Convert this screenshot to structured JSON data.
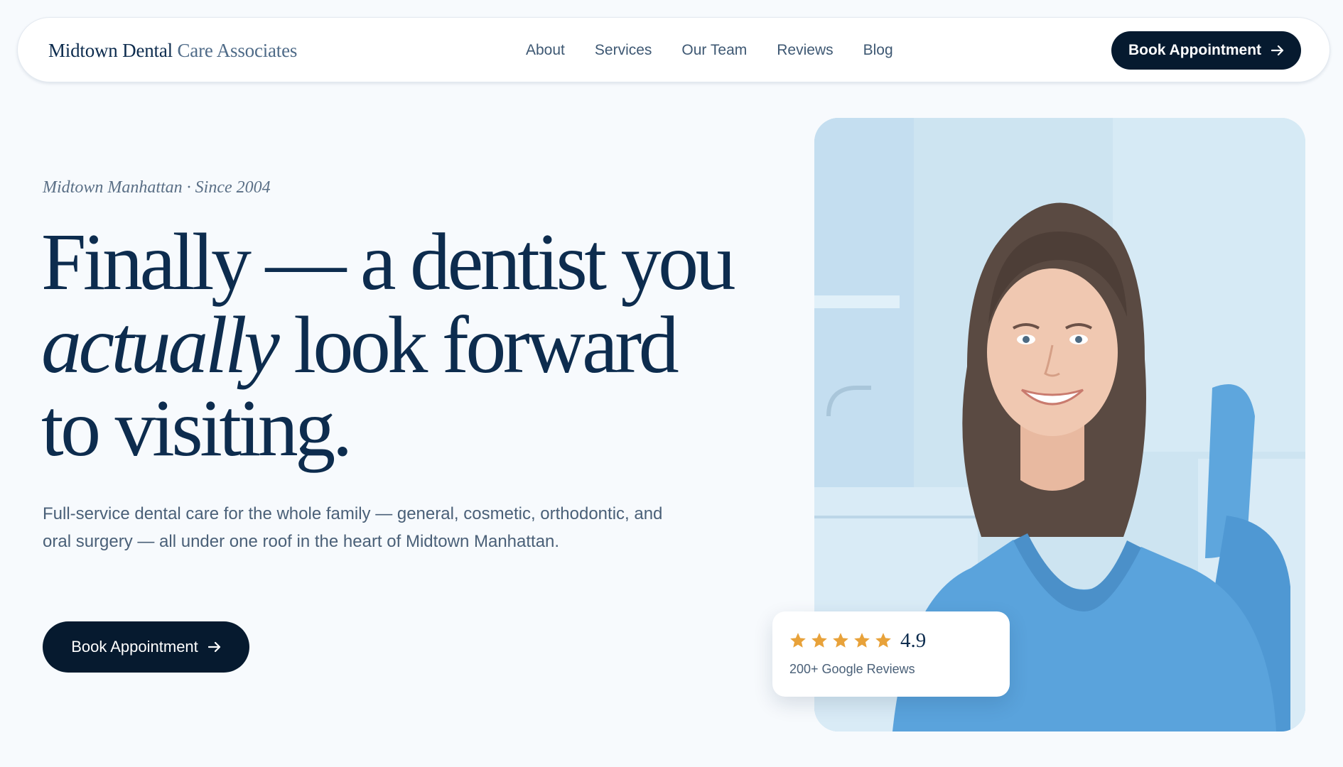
{
  "nav": {
    "brand_primary": "Midtown Dental",
    "brand_secondary": "Care Associates",
    "links": [
      "About",
      "Services",
      "Our Team",
      "Reviews",
      "Blog"
    ],
    "cta_label": "Book Appointment"
  },
  "hero": {
    "eyebrow": "Midtown Manhattan · Since 2004",
    "headline_line1": "Finally — a dentist you",
    "headline_italic": "actually",
    "headline_line2_rest": " look forward",
    "headline_line3": "to visiting.",
    "lede": "Full-service dental care for the whole family — general, cosmetic, orthodontic, and oral surgery — all under one roof in the heart of Midtown Manhattan.",
    "cta_label": "Book Appointment"
  },
  "rating": {
    "stars": 5,
    "score": "4.9",
    "reviews_label": "200+ Google Reviews"
  },
  "colors": {
    "navy": "#0d2c4e",
    "cta_dark": "#061a2f",
    "star_gold": "#e8a23a",
    "scrubs_blue": "#5aa3dc",
    "background": "#f7fafd"
  },
  "icons": {
    "cta_arrow": "arrow-right-icon",
    "rating_star": "star-icon"
  }
}
